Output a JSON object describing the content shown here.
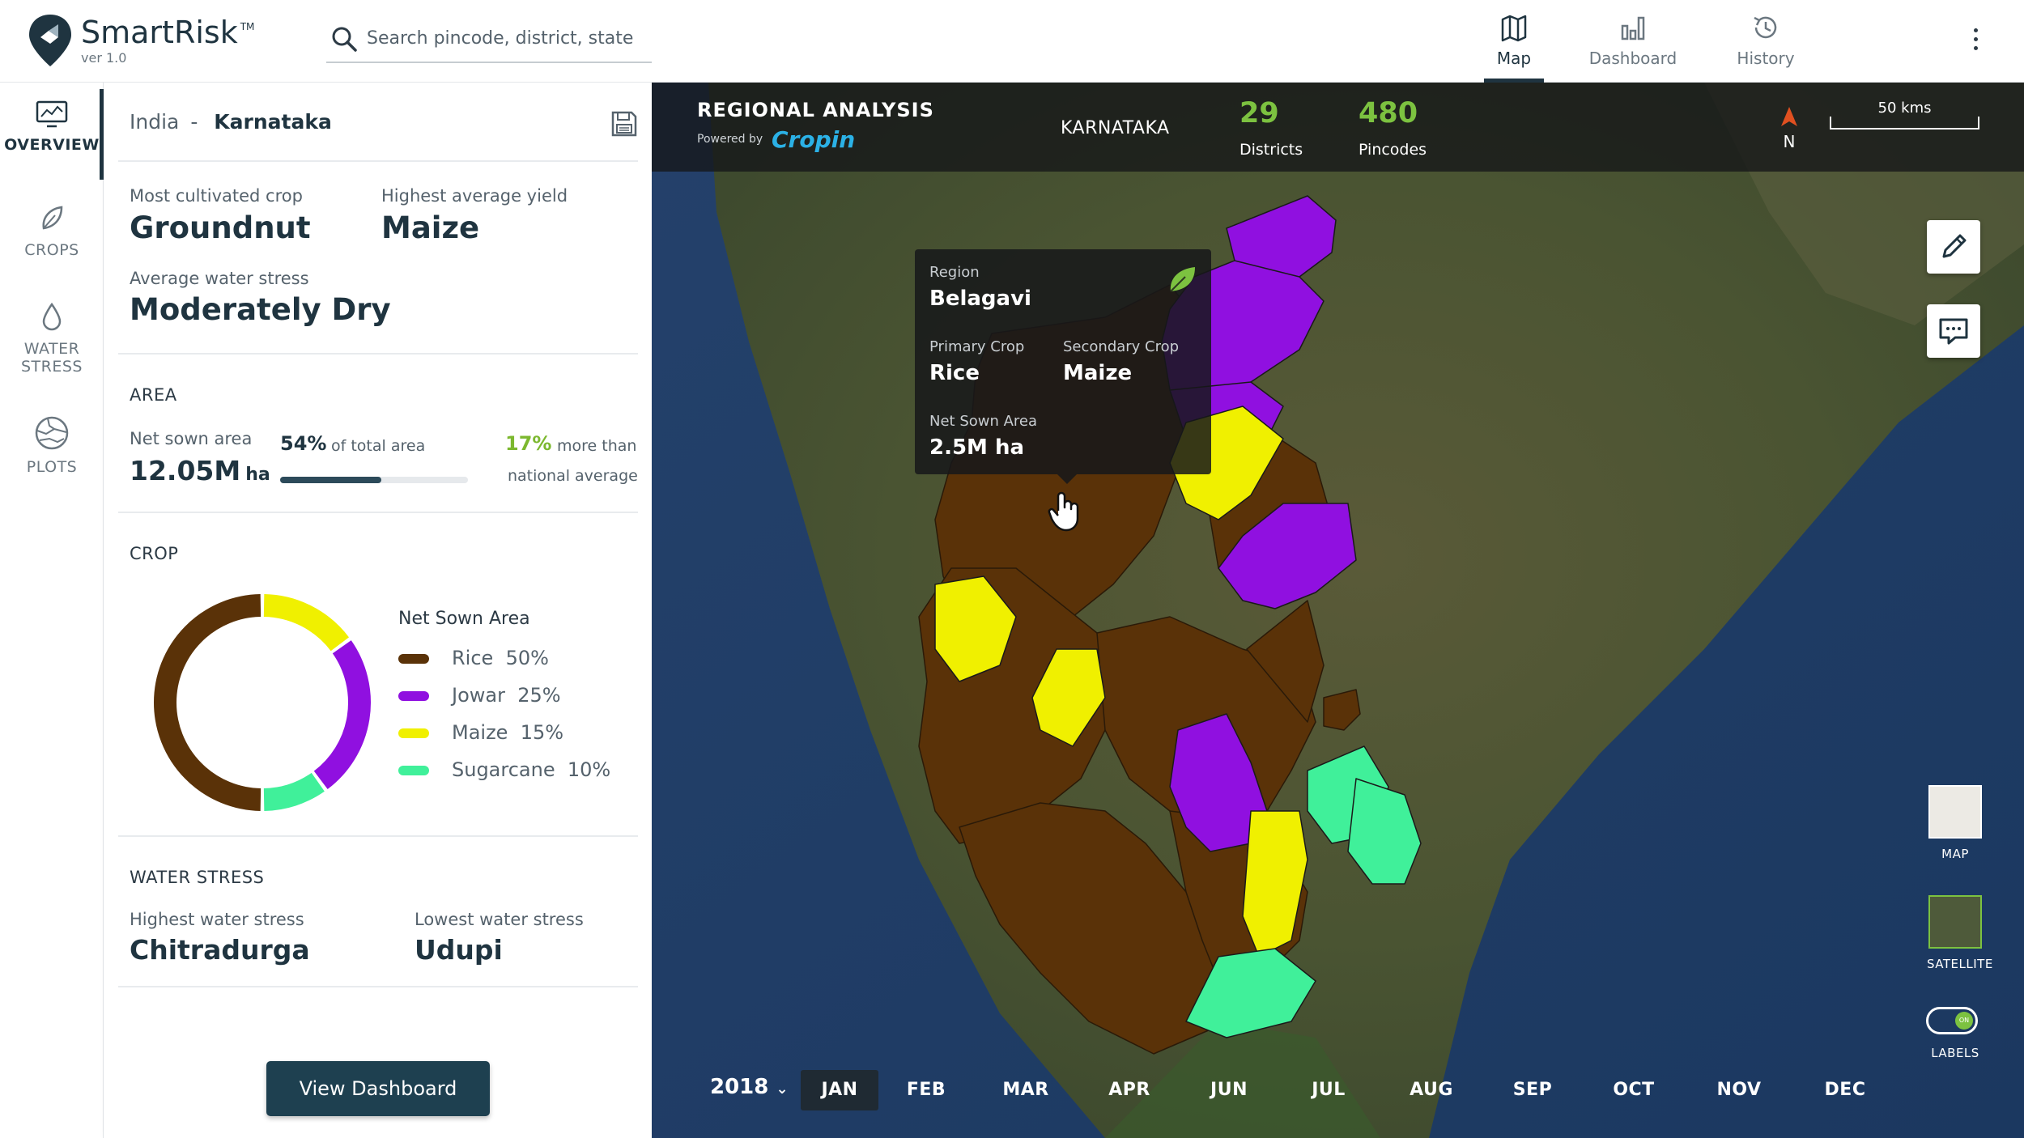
{
  "app": {
    "name": "SmartRisk",
    "tm": "TM",
    "version": "ver 1.0"
  },
  "search": {
    "placeholder": "Search pincode, district, state"
  },
  "nav": {
    "map": "Map",
    "dashboard": "Dashboard",
    "history": "History",
    "active": "Map"
  },
  "rail": {
    "overview": "OVERVIEW",
    "crops": "CROPS",
    "water_stress_1": "WATER",
    "water_stress_2": "STRESS",
    "plots": "PLOTS"
  },
  "panel": {
    "breadcrumb": {
      "country": "India",
      "sep": "-",
      "state": "Karnataka"
    },
    "most_cultivated_label": "Most cultivated crop",
    "most_cultivated_value": "Groundnut",
    "highest_yield_label": "Highest average yield",
    "highest_yield_value": "Maize",
    "water_stress_label": "Average water stress",
    "water_stress_value": "Moderately Dry",
    "area": {
      "title": "AREA",
      "net_sown_label": "Net sown area",
      "net_sown_value": "12.05M",
      "net_sown_unit": "ha",
      "pct_total": "54%",
      "pct_total_label": "of total area",
      "pct_total_fraction": 0.54,
      "pct_more": "17%",
      "pct_more_label_1": "more than",
      "pct_more_label_2": "national average"
    },
    "crop": {
      "title": "CROP",
      "legend_title": "Net Sown Area",
      "items": [
        {
          "name": "Rice",
          "pct": "50%",
          "value": 50,
          "color": "#5a3208"
        },
        {
          "name": "Jowar",
          "pct": "25%",
          "value": 25,
          "color": "#9010e0"
        },
        {
          "name": "Maize",
          "pct": "15%",
          "value": 15,
          "color": "#f0f000"
        },
        {
          "name": "Sugarcane",
          "pct": "10%",
          "value": 10,
          "color": "#40f09a"
        }
      ]
    },
    "water": {
      "title": "WATER STRESS",
      "highest_label": "Highest water stress",
      "highest_value": "Chitradurga",
      "lowest_label": "Lowest water stress",
      "lowest_value": "Udupi"
    },
    "button": "View Dashboard"
  },
  "map": {
    "title": "REGIONAL ANALYSIS",
    "powered_by": "Powered by",
    "brand": "Cropin",
    "state": "KARNATAKA",
    "districts_count": "29",
    "districts_label": "Districts",
    "pincodes_count": "480",
    "pincodes_label": "Pincodes",
    "north": "N",
    "scale": "50 kms",
    "tooltip": {
      "region_label": "Region",
      "region_value": "Belagavi",
      "primary_label": "Primary Crop",
      "primary_value": "Rice",
      "secondary_label": "Secondary Crop",
      "secondary_value": "Maize",
      "area_label": "Net Sown Area",
      "area_value": "2.5M ha"
    },
    "layers": {
      "map": "MAP",
      "satellite": "SATELLITE",
      "labels": "LABELS",
      "toggle": "ON"
    },
    "timeline": {
      "year": "2018",
      "months": [
        "JAN",
        "FEB",
        "MAR",
        "APR",
        "JUN",
        "JUL",
        "AUG",
        "SEP",
        "OCT",
        "NOV",
        "DEC"
      ],
      "active": "JAN"
    }
  }
}
